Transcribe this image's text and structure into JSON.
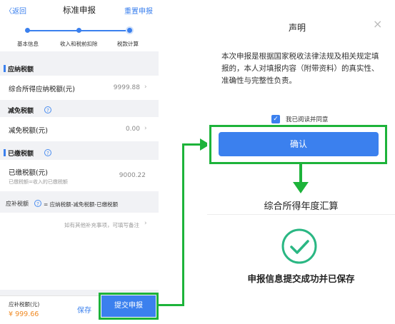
{
  "left": {
    "nav": {
      "back": "〈返回",
      "title": "标准申报",
      "reset": "重置申报"
    },
    "steps": [
      "基本信息",
      "收入和税前扣除",
      "税款计算"
    ],
    "sections": {
      "payable": {
        "title": "应纳税额",
        "row_label": "综合所得应纳税额(元)",
        "row_value": "9999.88"
      },
      "relief": {
        "title": "减免税额",
        "row_label": "减免税额(元)",
        "row_value": "0.00"
      },
      "paid": {
        "title": "已缴税额",
        "row_label": "已缴税额(元)",
        "row_sub": "已缴税额=收入的已缴税额",
        "row_value": "9000.22"
      }
    },
    "formula": {
      "label": "应补税额",
      "text": "= 应纳税额-减免税额-已缴税额"
    },
    "remark_hint": "如有其他补充事项，可填写备注",
    "bottom": {
      "due_label": "应补税额(元)",
      "due_value": "¥ 999.66",
      "save": "保存",
      "submit": "提交申报"
    }
  },
  "right": {
    "dialog": {
      "title": "声明",
      "body": "本次申报是根据国家税收法律法规及相关规定填报的，本人对填报内容（附带资料）的真实性、准确性与完整性负责。",
      "agree": "我已阅读并同意",
      "confirm": "确认"
    },
    "result": {
      "heading": "综合所得年度汇算",
      "message": "申报信息提交成功并已保存"
    }
  },
  "colors": {
    "primary": "#3b80ee",
    "highlight": "#1db33a",
    "success": "#2ab783",
    "due": "#f08a24"
  },
  "icons": {
    "close": "close-icon",
    "help": "help-icon",
    "chevron": "chevron-right-icon",
    "check": "checkmark-icon",
    "success": "success-check-icon"
  }
}
